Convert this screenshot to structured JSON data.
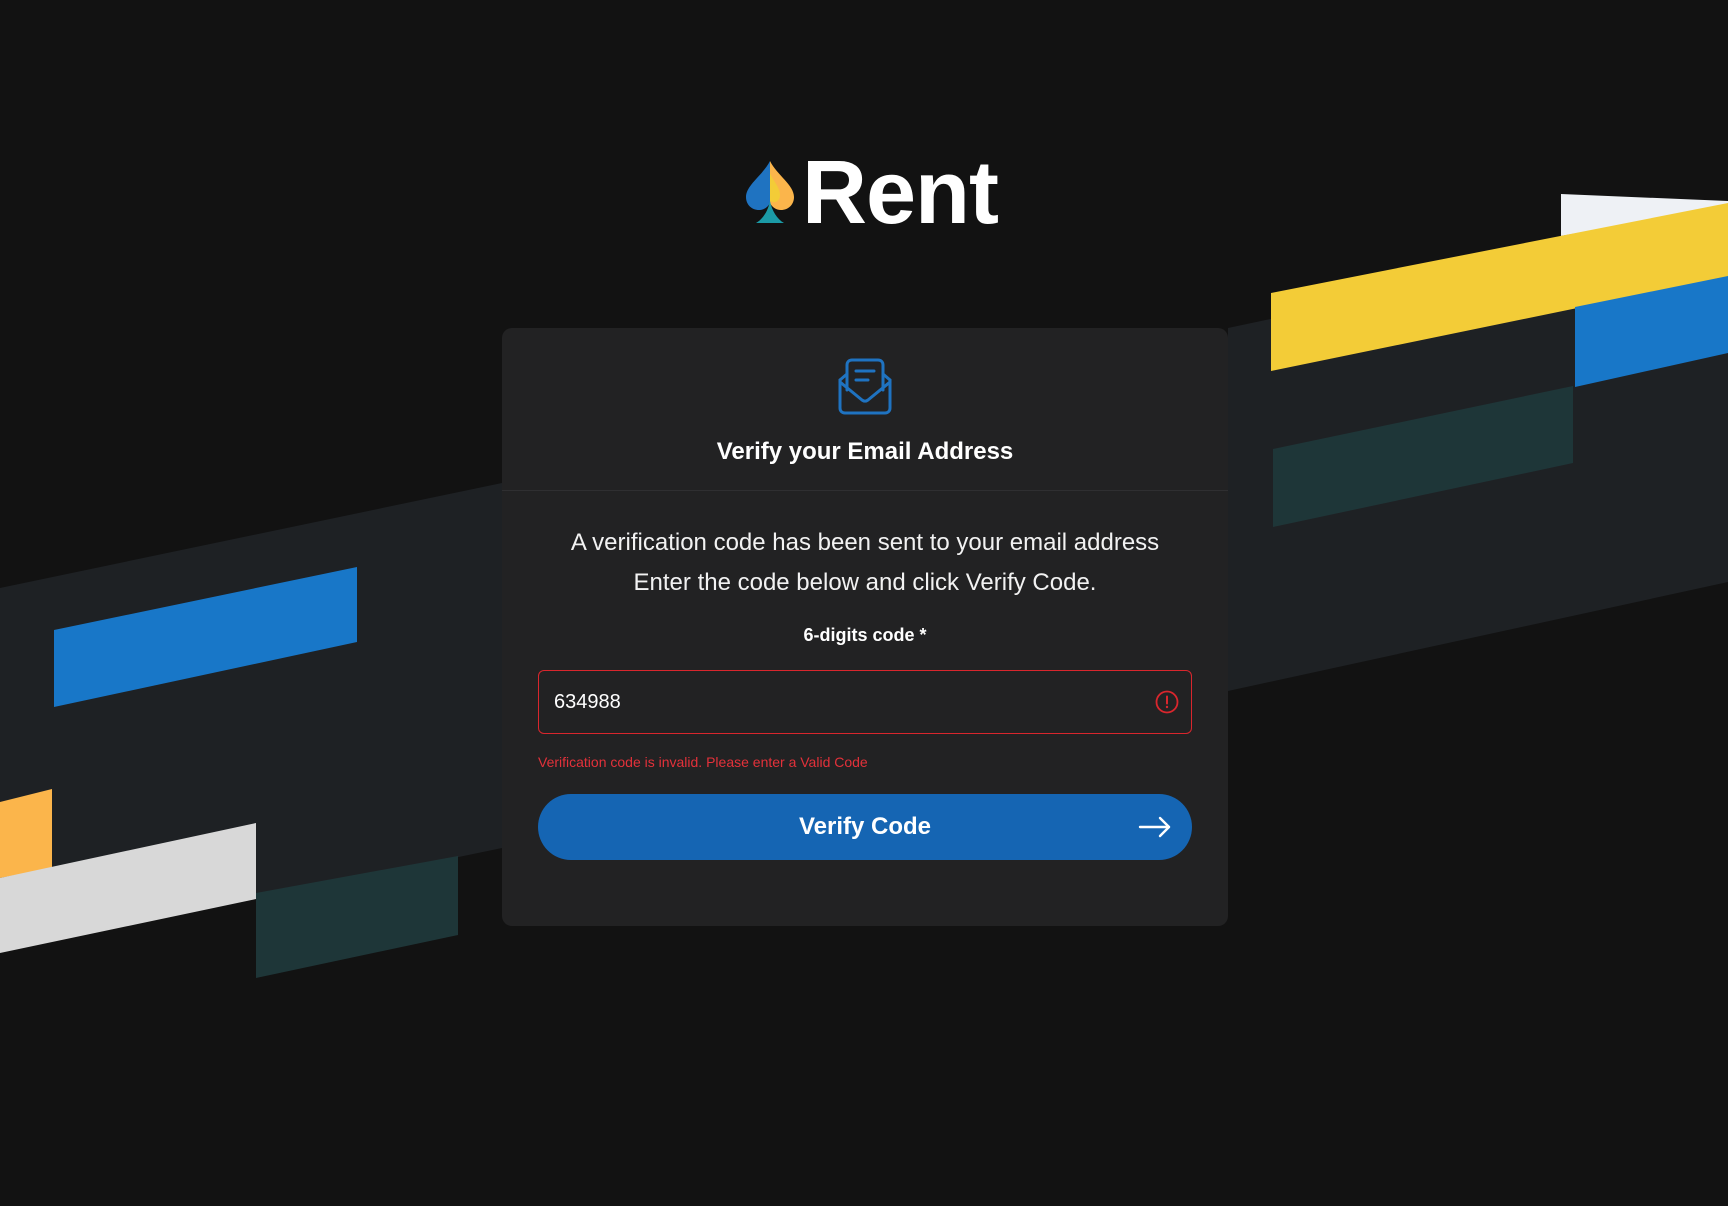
{
  "brand": {
    "name": "Rent",
    "logo_icon": "spade-icon"
  },
  "card": {
    "icon": "mail-open-icon",
    "title": "Verify your Email Address",
    "message_line1": "A verification code has been sent to your email address",
    "message_line2": "Enter the code below and click Verify Code.",
    "field_label": "6-digits code *",
    "code_value": "634988",
    "error_message": "Verification code is invalid. Please enter a Valid Code",
    "submit_label": "Verify Code"
  },
  "colors": {
    "background": "#121212",
    "card": "#222223",
    "accent_blue": "#1565b3",
    "error_red": "#d9262d",
    "stripe_yellow": "#f3cc37",
    "stripe_blue": "#1877c8",
    "stripe_orange": "#fbb54b",
    "stripe_teal": "#1e3638"
  }
}
